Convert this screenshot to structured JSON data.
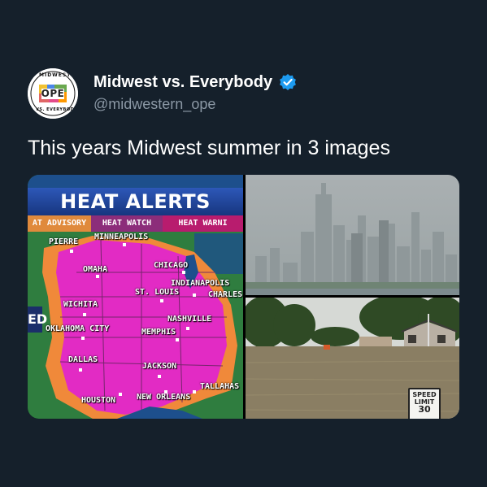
{
  "tweet": {
    "display_name": "Midwest vs. Everybody",
    "handle": "@midwestern_ope",
    "text": "This years Midwest summer in 3 images",
    "avatar": {
      "top_text": "MIDWEST",
      "center_text": "OPE",
      "bottom_text": "VS. EVERYBODY"
    },
    "verified_icon": "verified-badge-icon",
    "colors": {
      "background": "#15202b",
      "name": "#ffffff",
      "handle": "#8b98a5",
      "verified": "#1d9bf0"
    }
  },
  "media": {
    "map": {
      "title": "HEAT ALERTS",
      "legend": [
        "AT ADVISORY",
        "HEAT WATCH",
        "HEAT WARNI"
      ],
      "side_tab": "ED",
      "cities": {
        "pierre": "PIERRE",
        "minneapolis": "MINNEAPOLIS",
        "omaha": "OMAHA",
        "chicago": "CHICAGO",
        "indianapolis": "INDIANAPOLIS",
        "st_louis": "ST. LOUIS",
        "charleston": "CHARLES",
        "wichita": "WICHITA",
        "nashville": "NASHVILLE",
        "oklahoma_city": "OKLAHOMA CITY",
        "memphis": "MEMPHIS",
        "dallas": "DALLAS",
        "jackson": "JACKSON",
        "tallahassee": "TALLAHAS",
        "houston": "HOUSTON",
        "new_orleans": "NEW ORLEANS"
      },
      "colors": {
        "warning": "#e22bc4",
        "advisory": "#f0893a",
        "land": "#2f7d3f",
        "water": "#1d4f8c"
      }
    },
    "flood": {
      "sign_line1": "SPEED",
      "sign_line2": "LIMIT",
      "sign_line3": "30"
    }
  }
}
